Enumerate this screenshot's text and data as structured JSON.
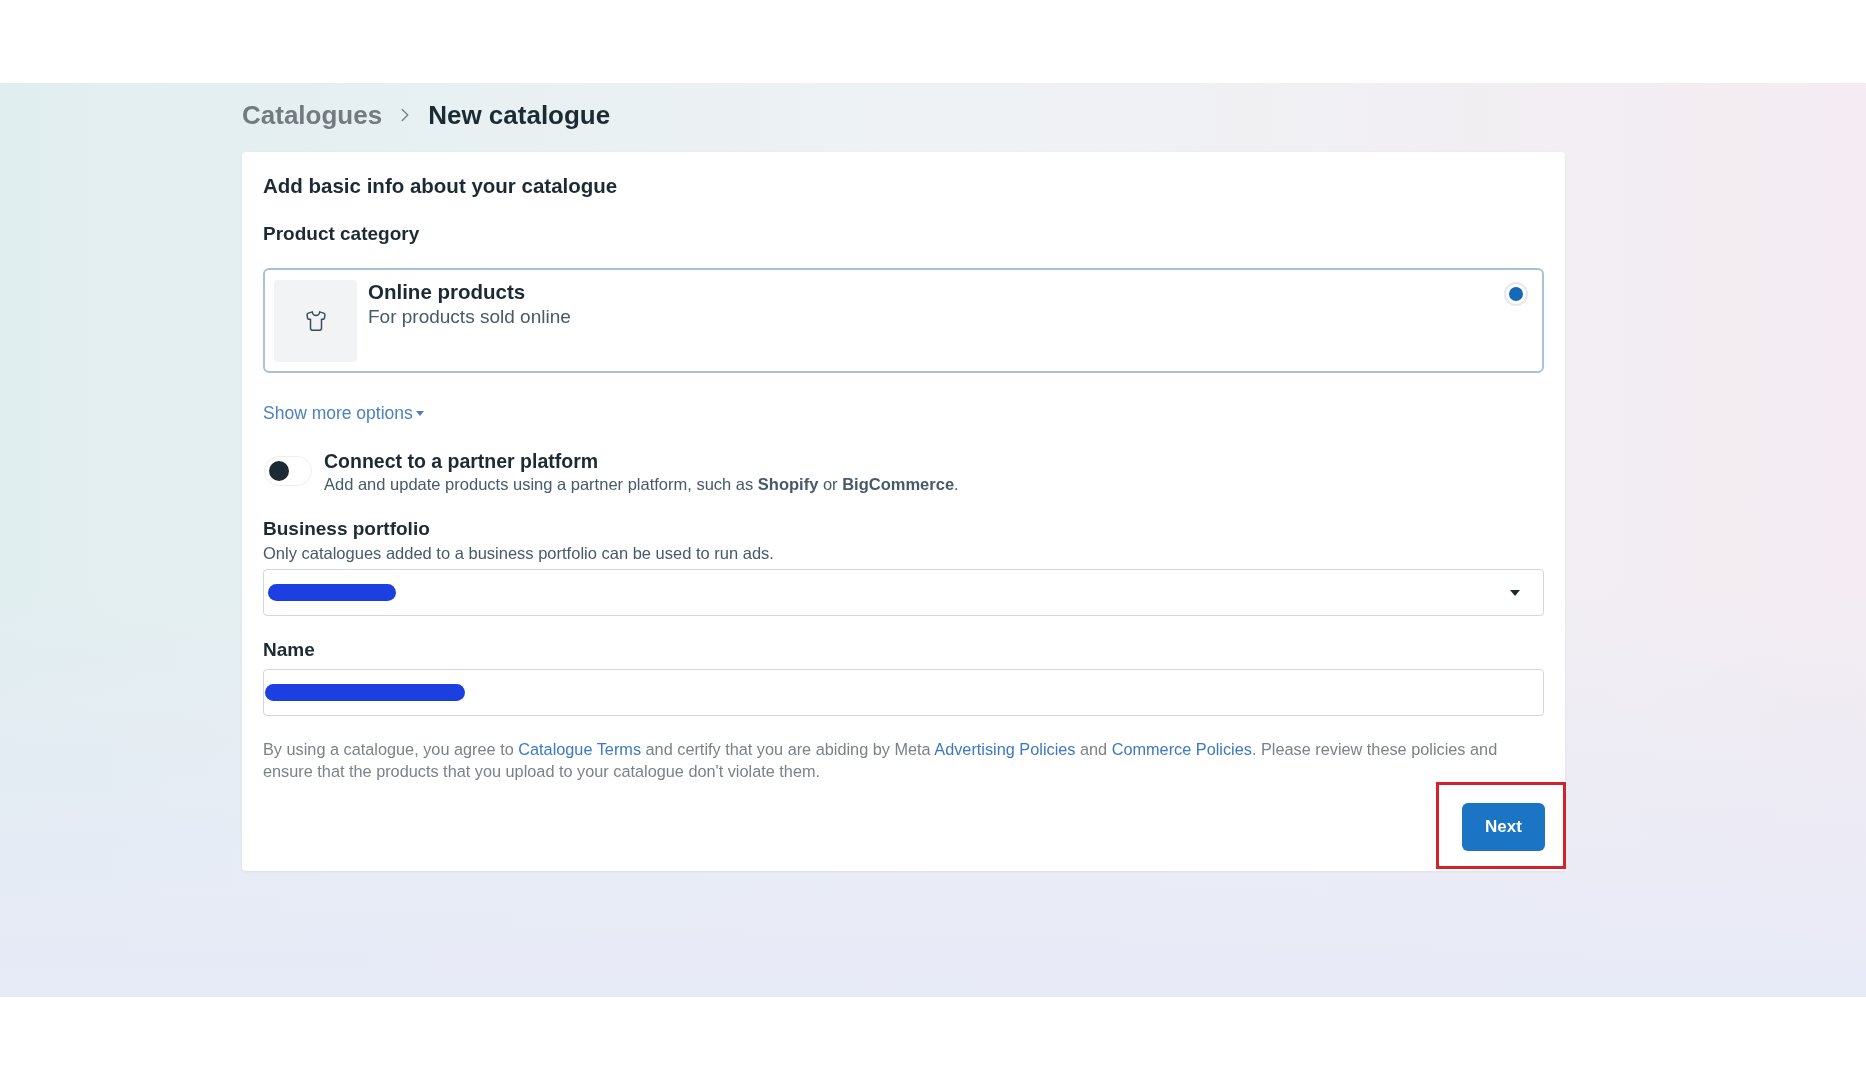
{
  "breadcrumb": [
    {
      "label": "Catalogues",
      "current": false
    },
    {
      "label": "New catalogue",
      "current": true
    }
  ],
  "form": {
    "heading": "Add basic info about your catalogue",
    "product_category": {
      "label": "Product category",
      "options": [
        {
          "title": "Online products",
          "description": "For products sold online",
          "selected": true
        }
      ]
    },
    "show_more": {
      "label": "Show more options",
      "expanded": false
    },
    "partner_platform": {
      "title": "Connect to a partner platform",
      "description": "Add and update products using a partner platform, such as **Shopify** or **BigCommerce**.",
      "on": false
    },
    "business_portfolio": {
      "label": "Business portfolio",
      "hint": "Only catalogues added to a business portfolio can be used to run ads.",
      "redacted": true
    },
    "name": {
      "label": "Name",
      "redacted": true
    },
    "terms": [
      {
        "kind": "text",
        "text": "By using a catalogue, you agree to "
      },
      {
        "kind": "link",
        "text": "Catalogue Terms"
      },
      {
        "kind": "text",
        "text": " and certify that you are abiding by Meta "
      },
      {
        "kind": "link",
        "text": "Advertising Policies"
      },
      {
        "kind": "text",
        "text": " and "
      },
      {
        "kind": "link",
        "text": "Commerce Policies"
      },
      {
        "kind": "text",
        "text": ". Please review these policies and ensure that the products that you upload to your catalogue don't violate them."
      }
    ],
    "next_button": {
      "label": "Next",
      "highlighted": true
    }
  }
}
